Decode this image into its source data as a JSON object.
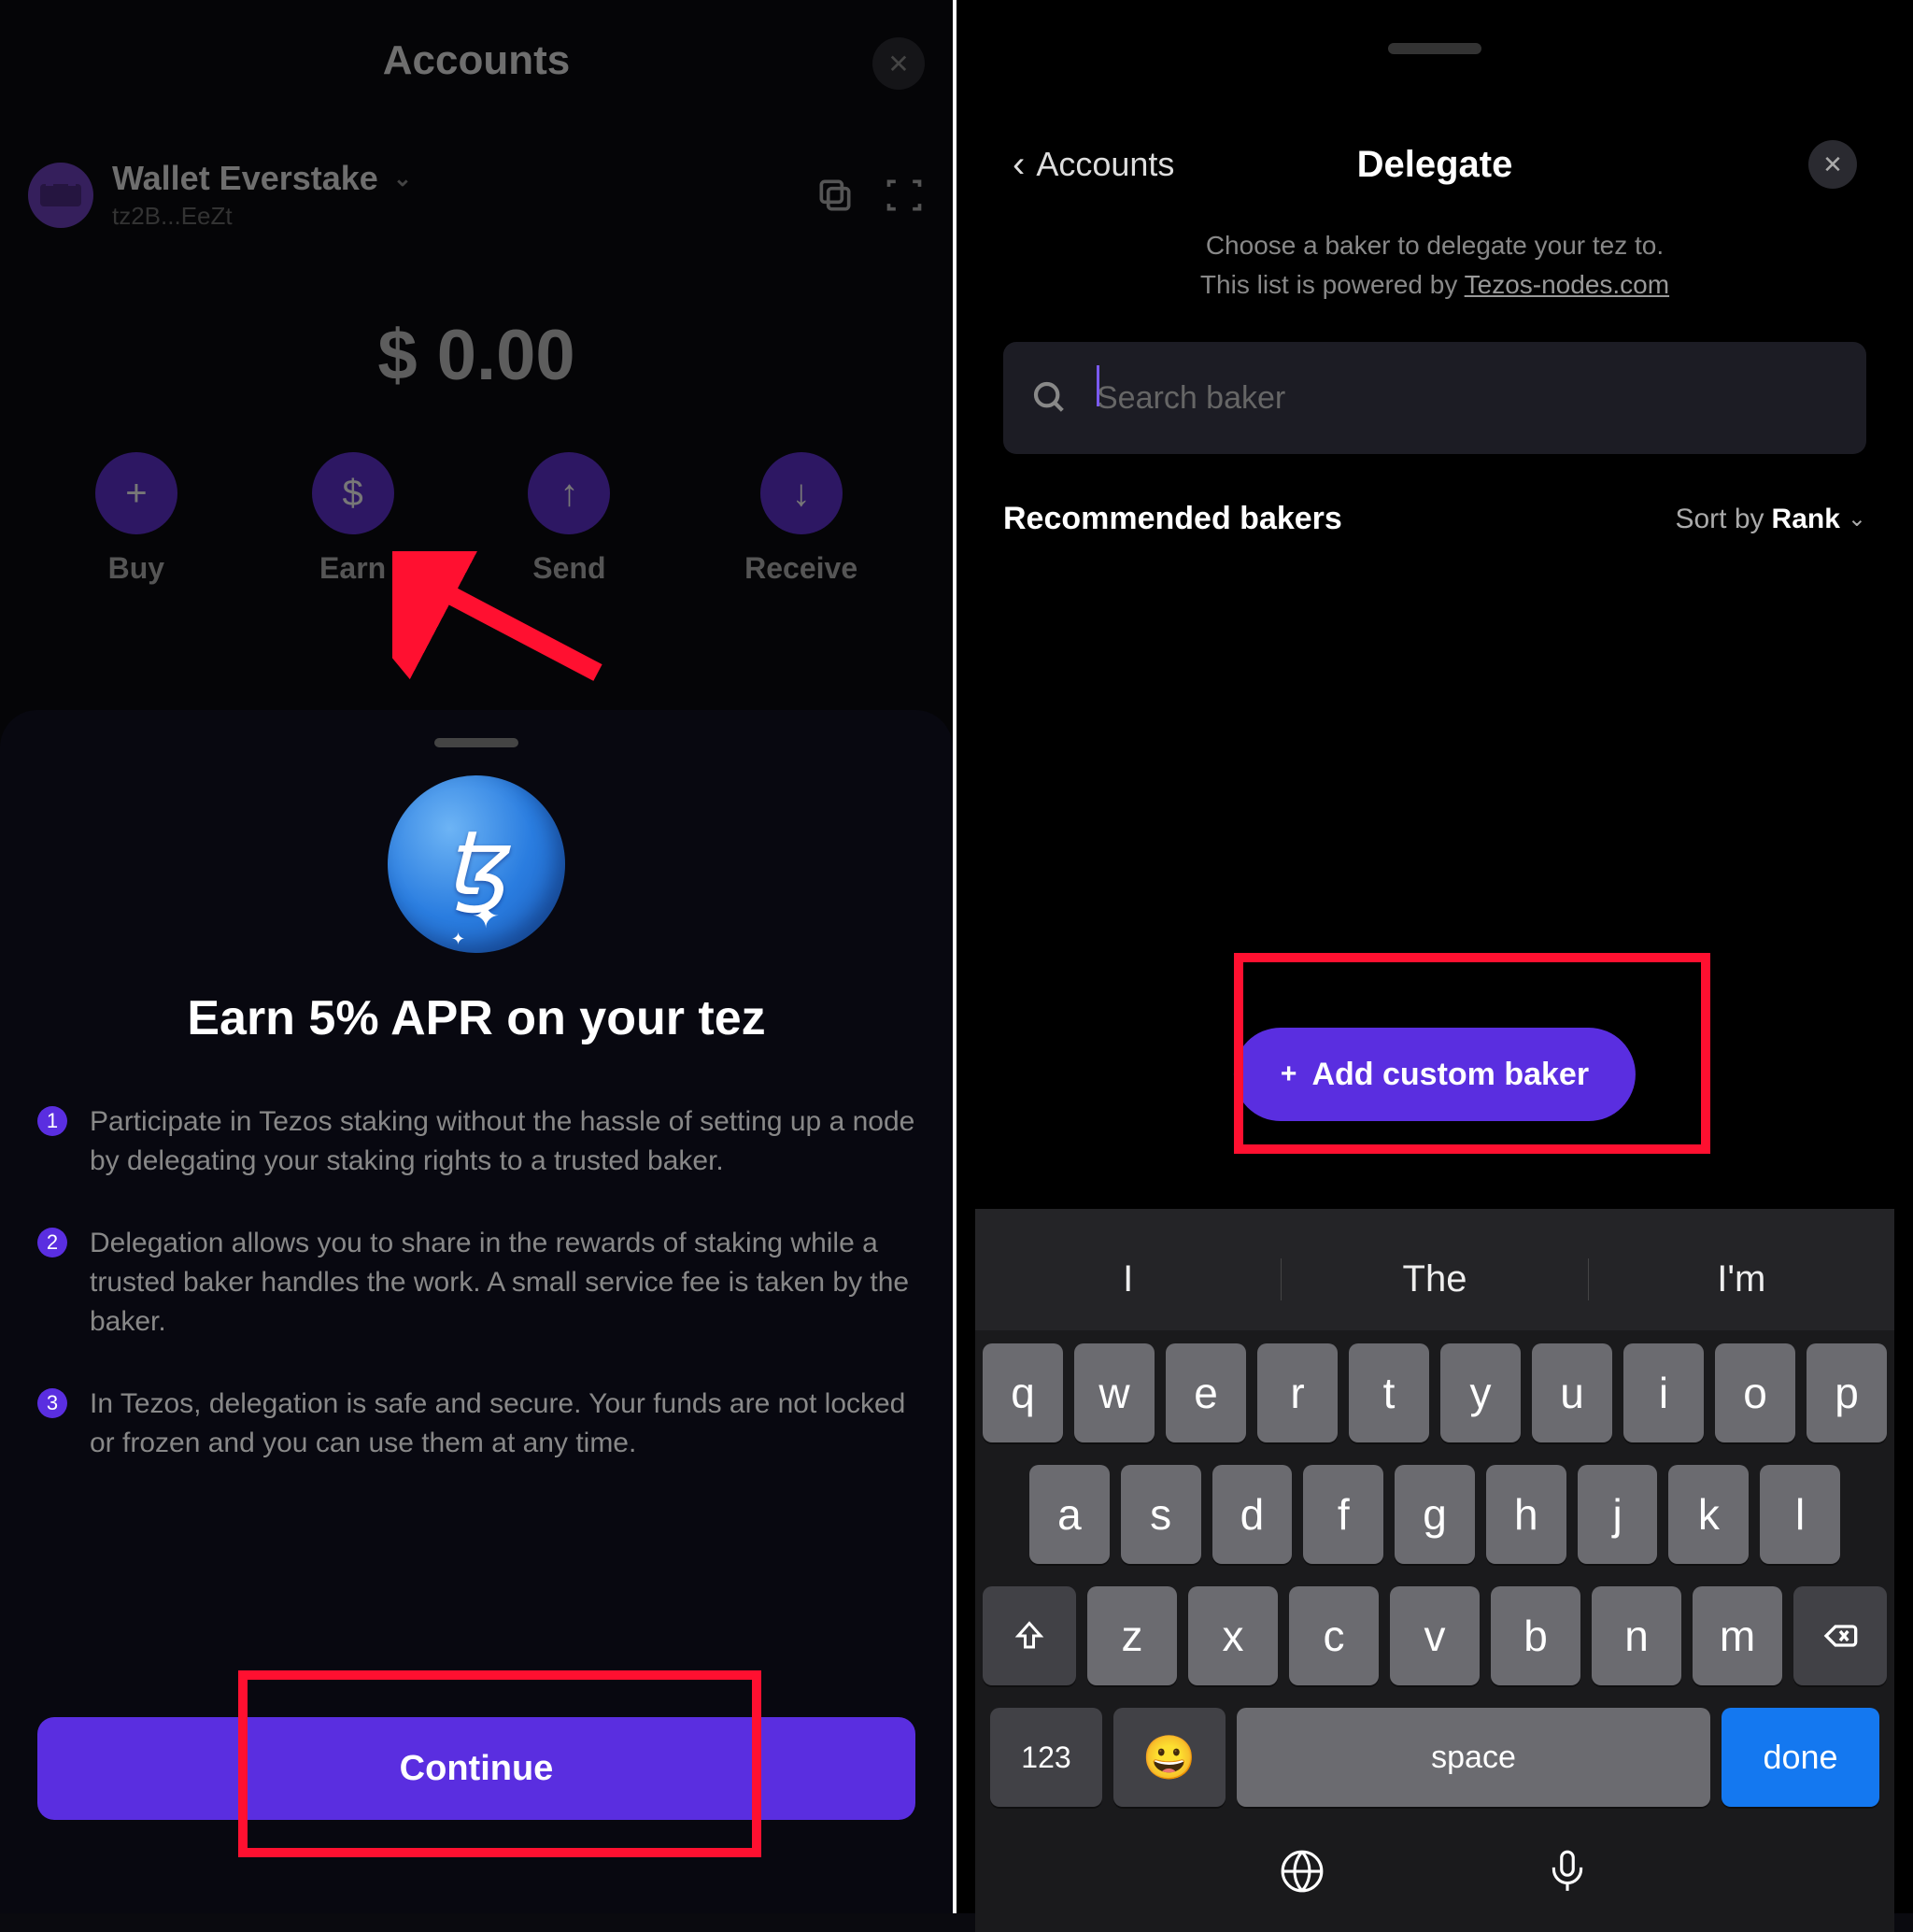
{
  "left": {
    "title": "Accounts",
    "wallet_name": "Wallet Everstake",
    "wallet_addr": "tz2B...EeZt",
    "balance": "$ 0.00",
    "actions": {
      "buy": "Buy",
      "earn": "Earn",
      "send": "Send",
      "receive": "Receive"
    },
    "sheet_title": "Earn 5% APR on your tez",
    "info": {
      "i1": "Participate in Tezos staking without the hassle of setting up a node by delegating your staking rights to a trusted baker.",
      "i2": "Delegation allows you to share in the rewards of staking while a trusted baker handles the work. A small service fee is taken by the baker.",
      "i3": "In Tezos, delegation is safe and secure. Your funds are not locked or frozen and you can use them at any time."
    },
    "continue": "Continue"
  },
  "right": {
    "back": "Accounts",
    "title": "Delegate",
    "sub1": "Choose a baker to delegate your tez to.",
    "sub2": "This list is powered by ",
    "sub_link": "Tezos-nodes.com",
    "search_placeholder": "Search baker",
    "rec_label": "Recommended bakers",
    "sort_by": "Sort by",
    "sort_val": "Rank",
    "add_custom": "Add custom baker",
    "suggestions": {
      "s1": "I",
      "s2": "The",
      "s3": "I'm"
    },
    "key_123": "123",
    "key_space": "space",
    "key_done": "done"
  }
}
